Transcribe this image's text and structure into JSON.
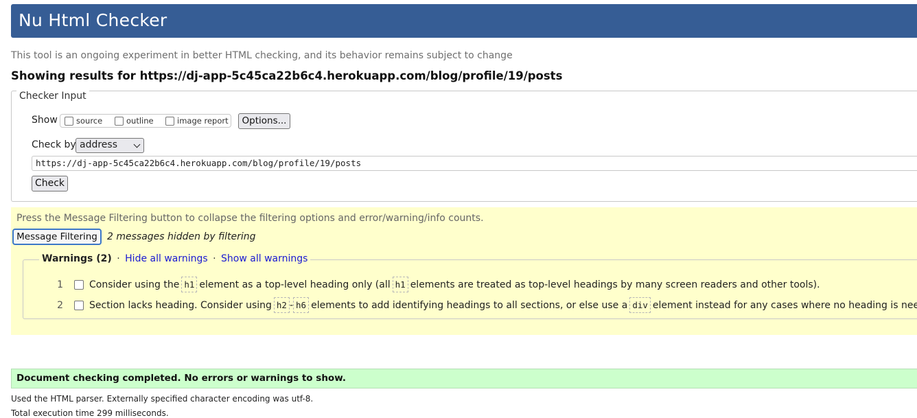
{
  "app": {
    "title": "Nu Html Checker"
  },
  "intro": "This tool is an ongoing experiment in better HTML checking, and its behavior remains subject to change",
  "results_title": "Showing results for https://dj-app-5c45ca22b6c4.herokuapp.com/blog/profile/19/posts",
  "checker_input": {
    "legend": "Checker Input",
    "show_label": "Show",
    "show_options": [
      "source",
      "outline",
      "image report"
    ],
    "options_button": "Options...",
    "check_by_label": "Check by",
    "check_by_value": "address",
    "url_value": "https://dj-app-5c45ca22b6c4.herokuapp.com/blog/profile/19/posts",
    "check_button": "Check"
  },
  "filtering": {
    "note": "Press the Message Filtering button to collapse the filtering options and error/warning/info counts.",
    "button": "Message Filtering",
    "hidden_note": "2 messages hidden by filtering",
    "warnings_title": "Warnings (2)",
    "separator": "·",
    "hide_all": "Hide all warnings",
    "show_all": "Show all warnings",
    "warnings": [
      {
        "num": "1",
        "text_a": "Consider using the",
        "code_a": "h1",
        "text_b": "element as a top-level heading only (all",
        "code_b": "h1",
        "text_c": "elements are treated as top-level headings by many screen readers and other tools)."
      },
      {
        "num": "2",
        "text_a": "Section lacks heading. Consider using",
        "code_a": "h2",
        "dash": "-",
        "code_b": "h6",
        "text_b": "elements to add identifying headings to all sections, or else use a",
        "code_c": "div",
        "text_c": "element instead for any cases where no heading is needed."
      }
    ]
  },
  "result": {
    "success": "Document checking completed. No errors or warnings to show.",
    "parser_note": "Used the HTML parser. Externally specified character encoding was utf-8.",
    "time_note": "Total execution time 299 milliseconds."
  },
  "colors": {
    "header_bg": "#365d95",
    "filter_bg": "#ffffcc",
    "success_bg": "#ccffcc",
    "link": "#1a1ad2"
  }
}
